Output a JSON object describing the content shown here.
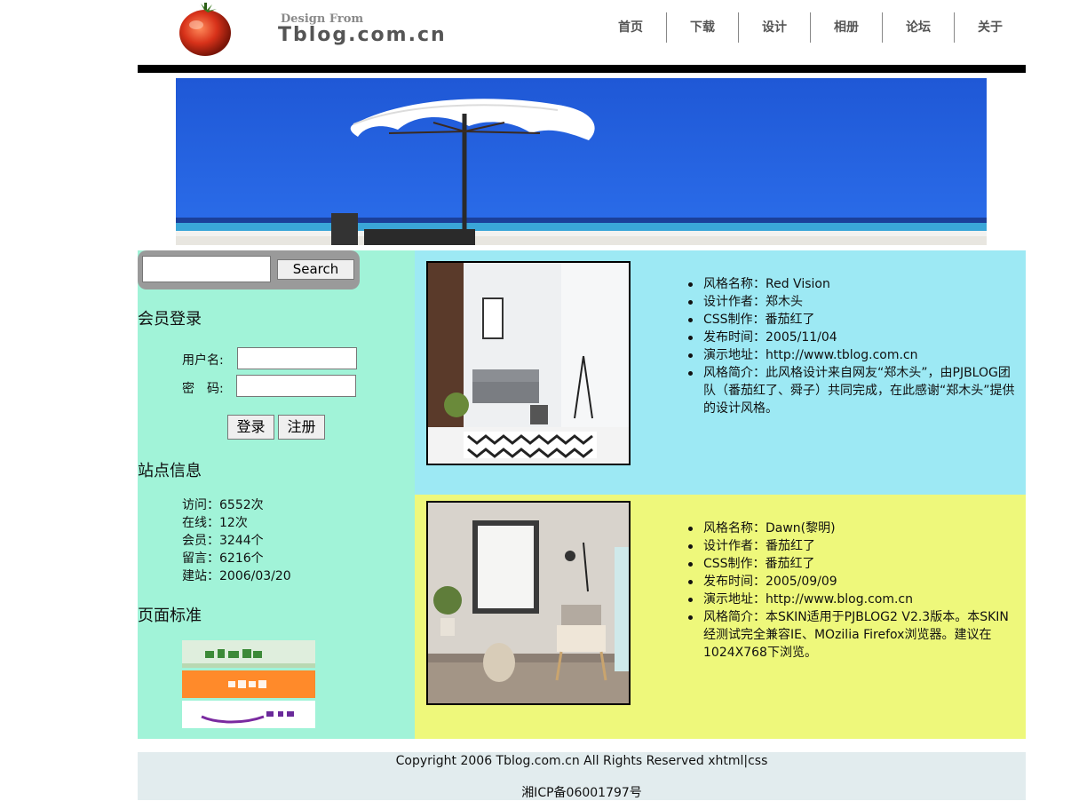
{
  "header": {
    "logo_small": "Design From",
    "logo_big": "Tblog.com.cn",
    "nav": [
      "首页",
      "下载",
      "设计",
      "相册",
      "论坛",
      "关于"
    ]
  },
  "search": {
    "button": "Search"
  },
  "login": {
    "title": "会员登录",
    "username_label": "用户名:",
    "password_label": "密　码:",
    "login_button": "登录",
    "register_button": "注册"
  },
  "site_info": {
    "title": "站点信息",
    "stats": [
      "访问：6552次",
      "在线：12次",
      "会员：3244个",
      "留言：6216个",
      "建站：2006/03/20"
    ]
  },
  "standards": {
    "title": "页面标准",
    "badge_colors": [
      "#d7e9d1",
      "#ff8a2a",
      "#ffffff"
    ]
  },
  "skins": [
    {
      "bg": "#9de9f4",
      "lines": [
        "风格名称：Red Vision",
        "设计作者：郑木头",
        "CSS制作：番茄红了",
        "发布时间：2005/11/04",
        "演示地址：http://www.tblog.com.cn",
        "风格简介：此风格设计来自网友“郑木头”，由PJBLOG团队（番茄红了、舜子）共同完成，在此感谢“郑木头”提供的设计风格。"
      ]
    },
    {
      "bg": "#eef87b",
      "lines": [
        "风格名称：Dawn(黎明)",
        "设计作者：番茄红了",
        "CSS制作：番茄红了",
        "发布时间：2005/09/09",
        "演示地址：http://www.blog.com.cn",
        "风格简介：本SKIN适用于PJBLOG2 V2.3版本。本SKIN经测试完全兼容IE、MOzilia Firefox浏览器。建议在1024X768下浏览。"
      ]
    }
  ],
  "footer": {
    "copyright": "Copyright 2006 Tblog.com.cn All Rights Reserved xhtml|css",
    "icp": "湘ICP备06001797号"
  }
}
